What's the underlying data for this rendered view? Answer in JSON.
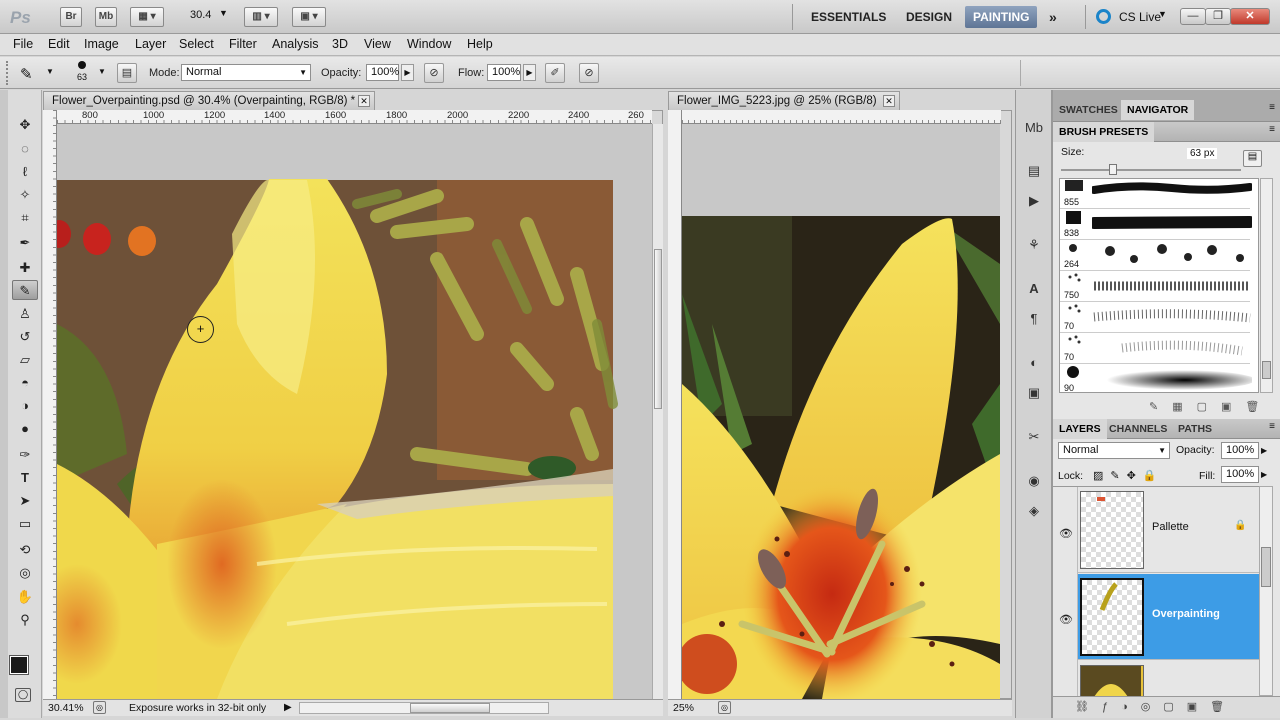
{
  "appbar": {
    "logo": "Ps",
    "bridge_label": "Br",
    "minibridge_label": "Mb",
    "zoom_value": "30.4",
    "workspaces": [
      "ESSENTIALS",
      "DESIGN",
      "PAINTING"
    ],
    "active_workspace": "PAINTING",
    "more_label": "»",
    "cslive_label": "CS Live"
  },
  "menu": [
    "File",
    "Edit",
    "Image",
    "Layer",
    "Select",
    "Filter",
    "Analysis",
    "3D",
    "View",
    "Window",
    "Help"
  ],
  "options": {
    "brush_size": "63",
    "mode_label": "Mode:",
    "mode_value": "Normal",
    "opacity_label": "Opacity:",
    "opacity_value": "100%",
    "flow_label": "Flow:",
    "flow_value": "100%"
  },
  "doc1": {
    "tab_title": "Flower_Overpainting.psd @ 30.4% (Overpainting, RGB/8) *",
    "ruler_ticks": [
      "800",
      "1000",
      "1200",
      "1400",
      "1600",
      "1800",
      "2000",
      "2200",
      "2400",
      "260"
    ],
    "zoom": "30.41%",
    "status_text": "Exposure works in 32-bit only"
  },
  "doc2": {
    "tab_title": "Flower_IMG_5223.jpg @ 25% (RGB/8)",
    "zoom": "25%"
  },
  "panels": {
    "top_tabs": [
      "SWATCHES",
      "NAVIGATOR"
    ],
    "brush_presets_title": "BRUSH PRESETS",
    "size_label": "Size:",
    "size_value": "63 px",
    "brushes": [
      {
        "num": "855"
      },
      {
        "num": "838"
      },
      {
        "num": "264"
      },
      {
        "num": "750"
      },
      {
        "num": "70"
      },
      {
        "num": "70"
      },
      {
        "num": "90"
      }
    ],
    "layer_tabs": [
      "LAYERS",
      "CHANNELS",
      "PATHS"
    ],
    "blend_mode": "Normal",
    "opacity_label": "Opacity:",
    "opacity_value": "100%",
    "lock_label": "Lock:",
    "fill_label": "Fill:",
    "fill_value": "100%",
    "layers": [
      {
        "name": "Pallette",
        "locked": true
      },
      {
        "name": "Overpainting",
        "selected": true
      },
      {
        "name": ""
      }
    ]
  },
  "colors": {
    "accent": "#3d9ce6",
    "foreground": "#1a1a1a",
    "background": "#7a1414",
    "active_workspace_bg": "#6b82a3"
  }
}
